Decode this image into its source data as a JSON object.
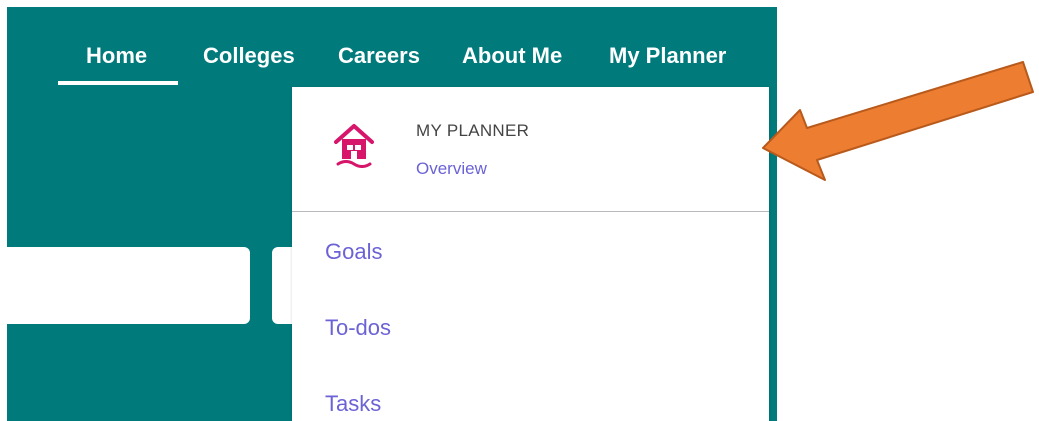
{
  "top_nav": {
    "items": [
      {
        "label": "Home",
        "active": true
      },
      {
        "label": "Colleges",
        "active": false
      },
      {
        "label": "Careers",
        "active": false
      },
      {
        "label": "About Me",
        "active": false
      },
      {
        "label": "My Planner",
        "active": false
      }
    ]
  },
  "dropdown": {
    "header_icon": "house-icon",
    "title": "MY PLANNER",
    "overview_link": "Overview",
    "items": [
      {
        "label": "Goals"
      },
      {
        "label": "To-dos"
      },
      {
        "label": "Tasks"
      }
    ]
  },
  "colors": {
    "panel_bg": "#007a7b",
    "link": "#6b62d6",
    "icon": "#d6156b",
    "annotation_arrow": "#ed7d31"
  }
}
